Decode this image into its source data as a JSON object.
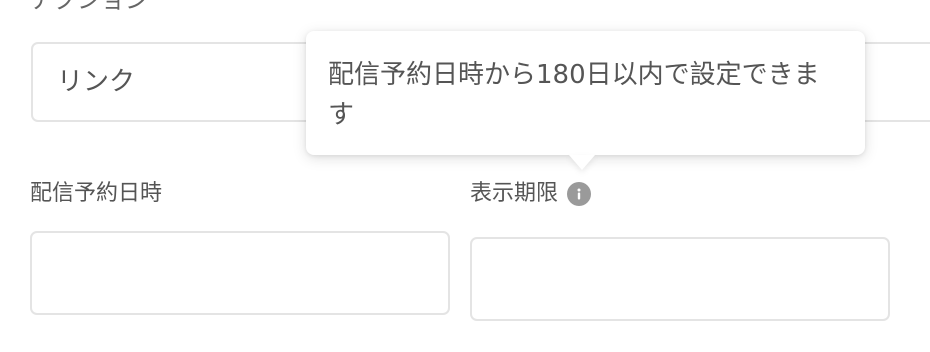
{
  "action": {
    "label": "アクション",
    "selected_value": "リンク"
  },
  "schedule": {
    "label": "配信予約日時",
    "value": ""
  },
  "display_period": {
    "label": "表示期限",
    "info_icon": "info-icon",
    "value": ""
  },
  "tooltip": {
    "text": "配信予約日時から180日以内で設定できます"
  },
  "colors": {
    "border": "#e4e4e4",
    "text": "#555555",
    "icon": "#9a9a9a",
    "background": "#ffffff"
  }
}
